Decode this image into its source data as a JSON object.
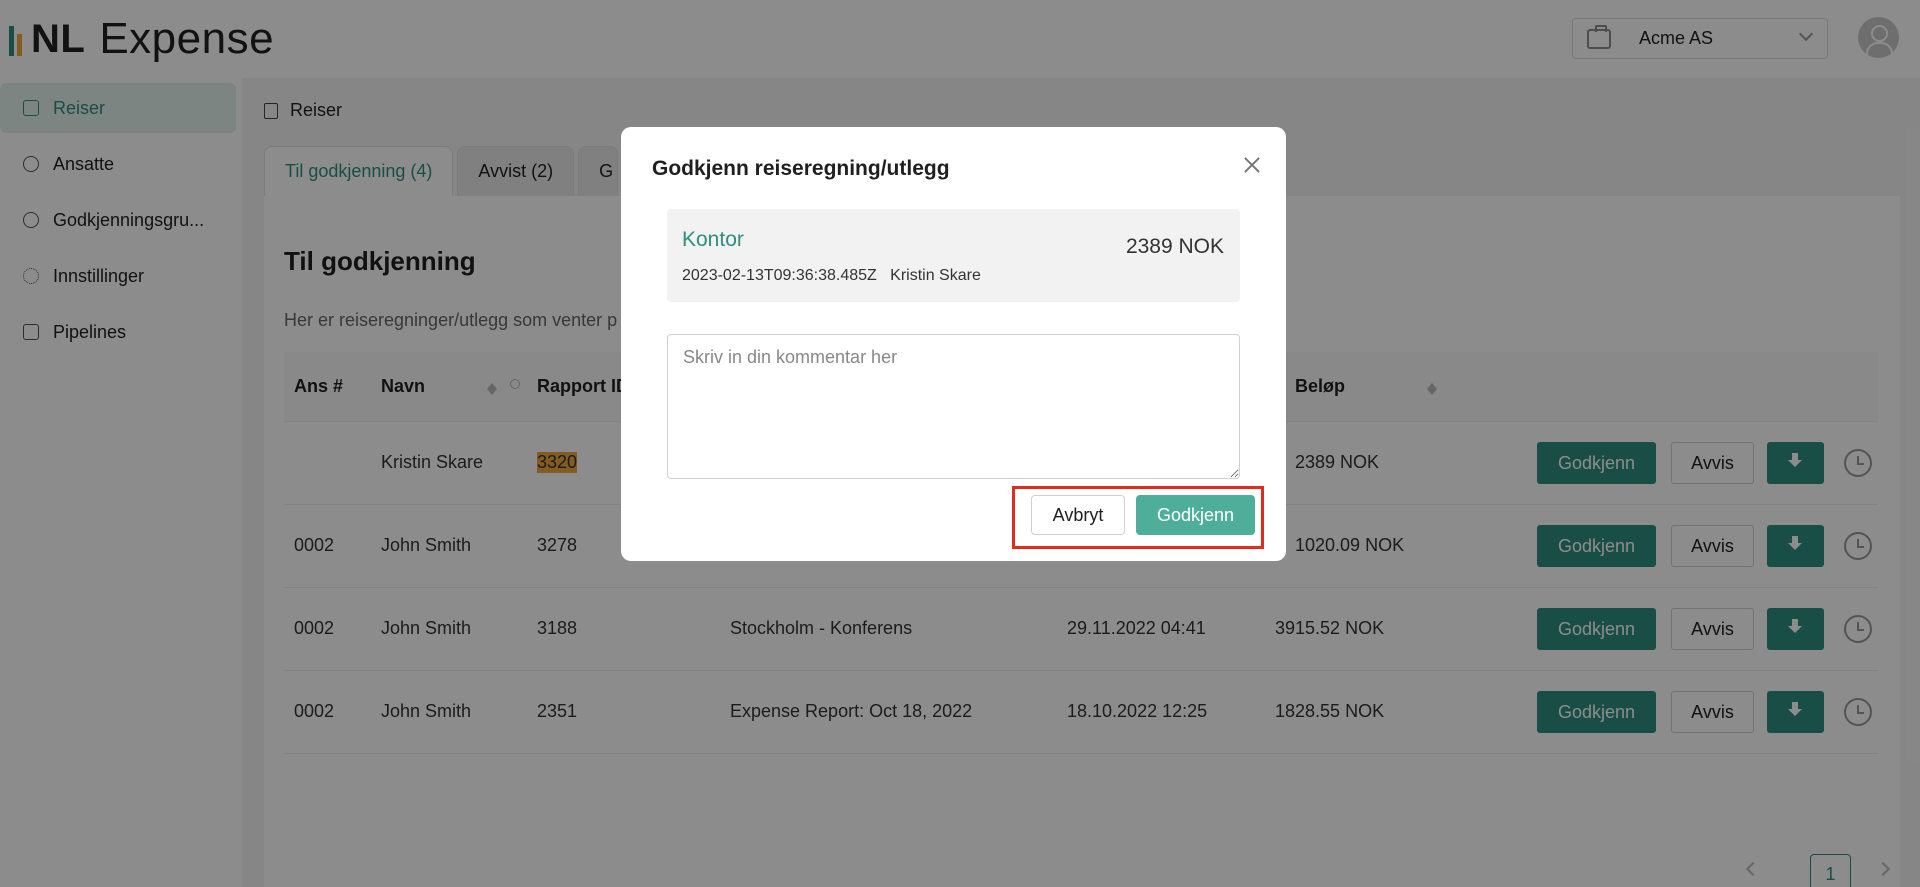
{
  "brand": {
    "mark": "NL",
    "name": "Expense"
  },
  "company": {
    "selected": "Acme AS",
    "icon": "briefcase-icon"
  },
  "sidebar": {
    "items": [
      {
        "label": "Reiser",
        "icon": "report-icon",
        "active": true
      },
      {
        "label": "Ansatte",
        "icon": "users-icon"
      },
      {
        "label": "Godkjenningsgru...",
        "icon": "pie-icon"
      },
      {
        "label": "Innstillinger",
        "icon": "gear-icon"
      },
      {
        "label": "Pipelines",
        "icon": "list-icon"
      }
    ]
  },
  "breadcrumb": "Reiser",
  "tabs": [
    {
      "label": "Til godkjenning (4)",
      "active": true
    },
    {
      "label": "Avvist (2)"
    },
    {
      "label": "G"
    }
  ],
  "page": {
    "title": "Til godkjenning",
    "description": "Her er reiseregninger/utlegg som venter p"
  },
  "table": {
    "columns": [
      "Ans #",
      "Navn",
      "Rapport ID",
      "",
      "",
      "Beløp"
    ],
    "rows": [
      {
        "ans": "",
        "navn": "Kristin Skare",
        "rapport": "3320",
        "beskrivelse": "",
        "dato": "",
        "belop": "2389 NOK"
      },
      {
        "ans": "0002",
        "navn": "John Smith",
        "rapport": "3278",
        "beskrivelse": "",
        "dato": "",
        "belop": "1020.09 NOK"
      },
      {
        "ans": "0002",
        "navn": "John Smith",
        "rapport": "3188",
        "beskrivelse": "Stockholm - Konferens",
        "dato": "29.11.2022 04:41",
        "belop": "3915.52 NOK"
      },
      {
        "ans": "0002",
        "navn": "John Smith",
        "rapport": "2351",
        "beskrivelse": "Expense Report: Oct 18, 2022",
        "dato": "18.10.2022 12:25",
        "belop": "1828.55 NOK"
      }
    ],
    "approve_label": "Godkjenn",
    "reject_label": "Avvis"
  },
  "pagination": {
    "current": "1"
  },
  "modal": {
    "title": "Godkjenn reiseregning/utlegg",
    "summary_title": "Kontor",
    "summary_meta": "2023-02-13T09:36:38.485Z   Kristin Skare",
    "summary_amount": "2389 NOK",
    "comment_placeholder": "Skriv in din kommentar her",
    "cancel_label": "Avbryt",
    "approve_label": "Godkjenn"
  },
  "colors": {
    "accent": "#2d8f7f",
    "highlight": "#e02b1d"
  }
}
